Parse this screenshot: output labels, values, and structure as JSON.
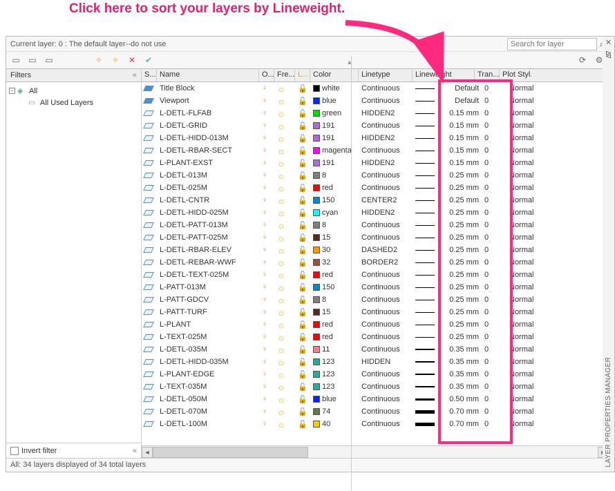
{
  "annotation": "Click here to sort your layers by Lineweight.",
  "current_layer_label": "Current layer: 0 : The default layer--do not use",
  "search_placeholder": "Search for layer",
  "filters_header": "Filters",
  "filters_tree": {
    "root": "All",
    "child": "All Used Layers"
  },
  "invert_filter_label": "Invert filter",
  "statusbar": "All: 34 layers displayed of 34 total layers",
  "vertical_title": "LAYER PROPERTIES MANAGER",
  "columns": {
    "status": "S...",
    "name": "Name",
    "on": "O...",
    "freeze": "Fre...",
    "lock": "L...",
    "color": "Color",
    "linetype": "Linetype",
    "lineweight": "Lineweight",
    "trans": "Tran...",
    "plot": "Plot Styl..."
  },
  "colors": {
    "white": "#ffffff",
    "blue": "#0026ff",
    "green": "#00e000",
    "191": "#b069d6",
    "magenta": "#ff00ff",
    "8": "#808080",
    "red": "#ff0000",
    "150": "#0088cc",
    "cyan": "#00ffff",
    "15": "#5a2a20",
    "30": "#ff9900",
    "32": "#a0522d",
    "11": "#ff8080",
    "123": "#2aa89a",
    "74": "#5a7a4a",
    "40": "#ffcc00"
  },
  "layers": [
    {
      "status": "active",
      "name": "Title Block",
      "color": "white",
      "colorhex": "#000000",
      "linetype": "Continuous",
      "lw": "Default",
      "lwpx": 1,
      "trans": "0",
      "plot": "Normal"
    },
    {
      "status": "active",
      "name": "Viewport",
      "color": "blue",
      "colorhex": "#0026ff",
      "linetype": "Continuous",
      "lw": "Default",
      "lwpx": 1,
      "trans": "0",
      "plot": "Normal"
    },
    {
      "status": "",
      "name": "L-DETL-FLFAB",
      "color": "green",
      "colorhex": "#00e000",
      "linetype": "HIDDEN2",
      "lw": "0.15 mm",
      "lwpx": 1,
      "trans": "0",
      "plot": "Normal"
    },
    {
      "status": "",
      "name": "L-DETL-GRID",
      "color": "191",
      "colorhex": "#b069d6",
      "linetype": "Continuous",
      "lw": "0.15 mm",
      "lwpx": 1,
      "trans": "0",
      "plot": "Normal"
    },
    {
      "status": "",
      "name": "L-DETL-HIDD-013M",
      "color": "191",
      "colorhex": "#b069d6",
      "linetype": "HIDDEN2",
      "lw": "0.15 mm",
      "lwpx": 1,
      "trans": "0",
      "plot": "Normal"
    },
    {
      "status": "",
      "name": "L-DETL-RBAR-SECT",
      "color": "magenta",
      "colorhex": "#ff00ff",
      "linetype": "Continuous",
      "lw": "0.15 mm",
      "lwpx": 1,
      "trans": "0",
      "plot": "Normal"
    },
    {
      "status": "",
      "name": "L-PLANT-EXST",
      "color": "191",
      "colorhex": "#b069d6",
      "linetype": "HIDDEN2",
      "lw": "0.15 mm",
      "lwpx": 1,
      "trans": "0",
      "plot": "Normal"
    },
    {
      "status": "",
      "name": "L-DETL-013M",
      "color": "8",
      "colorhex": "#808080",
      "linetype": "Continuous",
      "lw": "0.25 mm",
      "lwpx": 1,
      "trans": "0",
      "plot": "Normal"
    },
    {
      "status": "",
      "name": "L-DETL-025M",
      "color": "red",
      "colorhex": "#ff0000",
      "linetype": "Continuous",
      "lw": "0.25 mm",
      "lwpx": 1,
      "trans": "0",
      "plot": "Normal"
    },
    {
      "status": "",
      "name": "L-DETL-CNTR",
      "color": "150",
      "colorhex": "#0088cc",
      "linetype": "CENTER2",
      "lw": "0.25 mm",
      "lwpx": 1,
      "trans": "0",
      "plot": "Normal"
    },
    {
      "status": "",
      "name": "L-DETL-HIDD-025M",
      "color": "cyan",
      "colorhex": "#00ffff",
      "linetype": "HIDDEN2",
      "lw": "0.25 mm",
      "lwpx": 1,
      "trans": "0",
      "plot": "Normal"
    },
    {
      "status": "",
      "name": "L-DETL-PATT-013M",
      "color": "8",
      "colorhex": "#808080",
      "linetype": "Continuous",
      "lw": "0.25 mm",
      "lwpx": 1,
      "trans": "0",
      "plot": "Normal"
    },
    {
      "status": "",
      "name": "L-DETL-PATT-025M",
      "color": "15",
      "colorhex": "#5a2a20",
      "linetype": "Continuous",
      "lw": "0.25 mm",
      "lwpx": 1,
      "trans": "0",
      "plot": "Normal"
    },
    {
      "status": "",
      "name": "L-DETL-RBAR-ELEV",
      "color": "30",
      "colorhex": "#ff9900",
      "linetype": "DASHED2",
      "lw": "0.25 mm",
      "lwpx": 1,
      "trans": "0",
      "plot": "Normal"
    },
    {
      "status": "",
      "name": "L-DETL-REBAR-WWF",
      "color": "32",
      "colorhex": "#a0522d",
      "linetype": "BORDER2",
      "lw": "0.25 mm",
      "lwpx": 1,
      "trans": "0",
      "plot": "Normal"
    },
    {
      "status": "",
      "name": "L-DETL-TEXT-025M",
      "color": "red",
      "colorhex": "#ff0000",
      "linetype": "Continuous",
      "lw": "0.25 mm",
      "lwpx": 1,
      "trans": "0",
      "plot": "Normal"
    },
    {
      "status": "",
      "name": "L-PATT-013M",
      "color": "150",
      "colorhex": "#0088cc",
      "linetype": "Continuous",
      "lw": "0.25 mm",
      "lwpx": 1,
      "trans": "0",
      "plot": "Normal"
    },
    {
      "status": "",
      "name": "L-PATT-GDCV",
      "color": "8",
      "colorhex": "#808080",
      "linetype": "Continuous",
      "lw": "0.25 mm",
      "lwpx": 1,
      "trans": "0",
      "plot": "Normal"
    },
    {
      "status": "",
      "name": "L-PATT-TURF",
      "color": "15",
      "colorhex": "#5a2a20",
      "linetype": "Continuous",
      "lw": "0.25 mm",
      "lwpx": 1,
      "trans": "0",
      "plot": "Normal"
    },
    {
      "status": "",
      "name": "L-PLANT",
      "color": "red",
      "colorhex": "#ff0000",
      "linetype": "Continuous",
      "lw": "0.25 mm",
      "lwpx": 1,
      "trans": "0",
      "plot": "Normal"
    },
    {
      "status": "",
      "name": "L-TEXT-025M",
      "color": "red",
      "colorhex": "#ff0000",
      "linetype": "Continuous",
      "lw": "0.25 mm",
      "lwpx": 1,
      "trans": "0",
      "plot": "Normal"
    },
    {
      "status": "",
      "name": "L-DETL-035M",
      "color": "11",
      "colorhex": "#ff8080",
      "linetype": "Continuous",
      "lw": "0.35 mm",
      "lwpx": 2,
      "trans": "0",
      "plot": "Normal"
    },
    {
      "status": "",
      "name": "L-DETL-HIDD-035M",
      "color": "123",
      "colorhex": "#2aa89a",
      "linetype": "HIDDEN",
      "lw": "0.35 mm",
      "lwpx": 2,
      "trans": "0",
      "plot": "Normal"
    },
    {
      "status": "",
      "name": "L-PLANT-EDGE",
      "color": "123",
      "colorhex": "#2aa89a",
      "linetype": "Continuous",
      "lw": "0.35 mm",
      "lwpx": 2,
      "trans": "0",
      "plot": "Normal"
    },
    {
      "status": "",
      "name": "L-TEXT-035M",
      "color": "123",
      "colorhex": "#2aa89a",
      "linetype": "Continuous",
      "lw": "0.35 mm",
      "lwpx": 2,
      "trans": "0",
      "plot": "Normal"
    },
    {
      "status": "",
      "name": "L-DETL-050M",
      "color": "blue",
      "colorhex": "#0026ff",
      "linetype": "Continuous",
      "lw": "0.50 mm",
      "lwpx": 3,
      "trans": "0",
      "plot": "Normal"
    },
    {
      "status": "",
      "name": "L-DETL-070M",
      "color": "74",
      "colorhex": "#5a7a4a",
      "linetype": "Continuous",
      "lw": "0.70 mm",
      "lwpx": 5,
      "trans": "0",
      "plot": "Normal"
    },
    {
      "status": "",
      "name": "L-DETL-100M",
      "color": "40",
      "colorhex": "#ffcc00",
      "linetype": "Continuous",
      "lw": "0.70 mm",
      "lwpx": 5,
      "trans": "0",
      "plot": "Normal"
    }
  ]
}
